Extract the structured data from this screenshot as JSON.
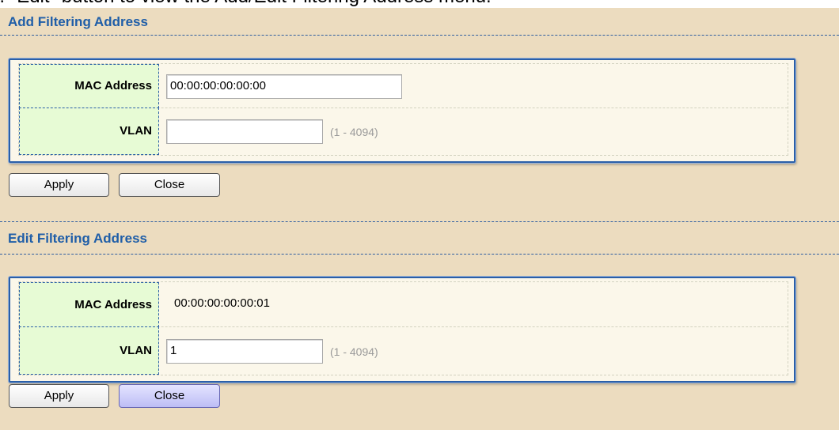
{
  "doc_caption": "Edit\" button to view the Add/Edit Filtering Address menu.",
  "add_section": {
    "title": "Add Filtering Address",
    "mac_label": "MAC Address",
    "mac_value": "00:00:00:00:00:00",
    "vlan_label": "VLAN",
    "vlan_value": "",
    "vlan_hint": "(1 - 4094)",
    "apply_label": "Apply",
    "close_label": "Close"
  },
  "edit_section": {
    "title": "Edit Filtering Address",
    "mac_label": "MAC Address",
    "mac_value": "00:00:00:00:00:01",
    "vlan_label": "VLAN",
    "vlan_value": "1",
    "vlan_hint": "(1 - 4094)",
    "apply_label": "Apply",
    "close_label": "Close"
  },
  "colors": {
    "panel_bg": "#ecdcbf",
    "title": "#1f5ea8",
    "label_bg": "#e7fbd5",
    "form_bg": "#fbf7ea",
    "close_hover": "#bdbdf5"
  }
}
